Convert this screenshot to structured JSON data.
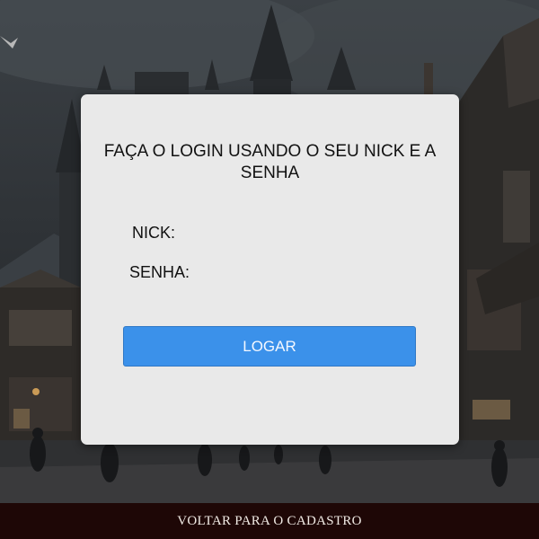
{
  "login_card": {
    "title": "FAÇA O LOGIN USANDO O SEU NICK E A SENHA",
    "nick_label": "NICK:",
    "nick_value": "",
    "password_label": "SENHA:",
    "password_value": "",
    "submit_label": "LOGAR"
  },
  "footer": {
    "back_link": "VOLTAR PARA O CADASTRO"
  },
  "colors": {
    "card_background": "#e9e9e9",
    "button_blue": "#3b91ea",
    "footer_background": "#1e0706"
  }
}
